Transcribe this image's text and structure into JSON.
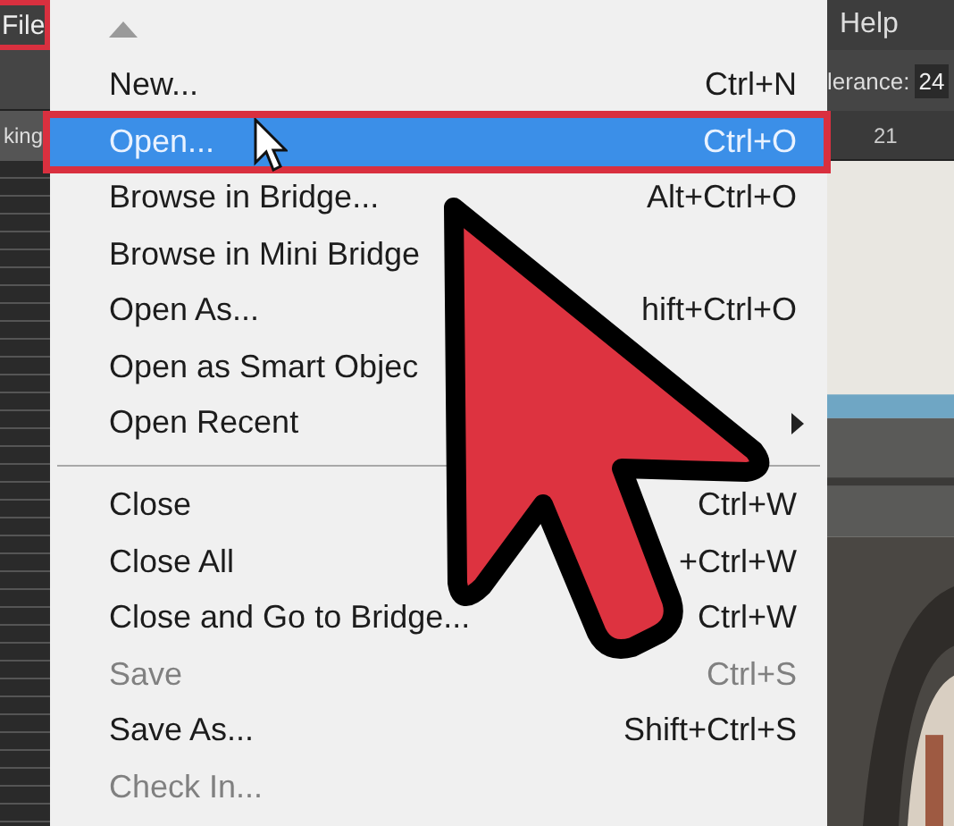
{
  "menubar": {
    "file": {
      "label": "File",
      "selected": true
    },
    "help": "Help"
  },
  "toolbar": {
    "tolerance_label": "lerance:",
    "tolerance_value": "24"
  },
  "document_tab": "king",
  "ruler_label": "21",
  "menu": {
    "items": [
      {
        "kind": "item",
        "label": "New...",
        "shortcut": "Ctrl+N",
        "selected": false,
        "disabled": false,
        "submenu": false
      },
      {
        "kind": "item",
        "label": "Open...",
        "shortcut": "Ctrl+O",
        "selected": true,
        "disabled": false,
        "submenu": false
      },
      {
        "kind": "item",
        "label": "Browse in Bridge...",
        "shortcut": "Alt+Ctrl+O",
        "selected": false,
        "disabled": false,
        "submenu": false
      },
      {
        "kind": "item",
        "label": "Browse in Mini Bridge",
        "selected": false,
        "disabled": false,
        "submenu": false
      },
      {
        "kind": "item",
        "label": "Open As...",
        "shortcut": "hift+Ctrl+O",
        "selected": false,
        "disabled": false,
        "submenu": false
      },
      {
        "kind": "item",
        "label": "Open as Smart Objec",
        "selected": false,
        "disabled": false,
        "submenu": false
      },
      {
        "kind": "item",
        "label": "Open Recent",
        "selected": false,
        "disabled": false,
        "submenu": true
      },
      {
        "kind": "separator"
      },
      {
        "kind": "item",
        "label": "Close",
        "shortcut": "Ctrl+W",
        "selected": false,
        "disabled": false,
        "submenu": false
      },
      {
        "kind": "item",
        "label": "Close All",
        "shortcut": "+Ctrl+W",
        "selected": false,
        "disabled": false,
        "submenu": false
      },
      {
        "kind": "item",
        "label": "Close and Go to Bridge...",
        "shortcut": "Ctrl+W",
        "selected": false,
        "disabled": false,
        "submenu": false
      },
      {
        "kind": "item",
        "label": "Save",
        "shortcut": "Ctrl+S",
        "selected": false,
        "disabled": true,
        "submenu": false
      },
      {
        "kind": "item",
        "label": "Save As...",
        "shortcut": "Shift+Ctrl+S",
        "selected": false,
        "disabled": false,
        "submenu": false
      },
      {
        "kind": "item",
        "label": "Check In...",
        "selected": false,
        "disabled": true,
        "submenu": false
      }
    ]
  }
}
